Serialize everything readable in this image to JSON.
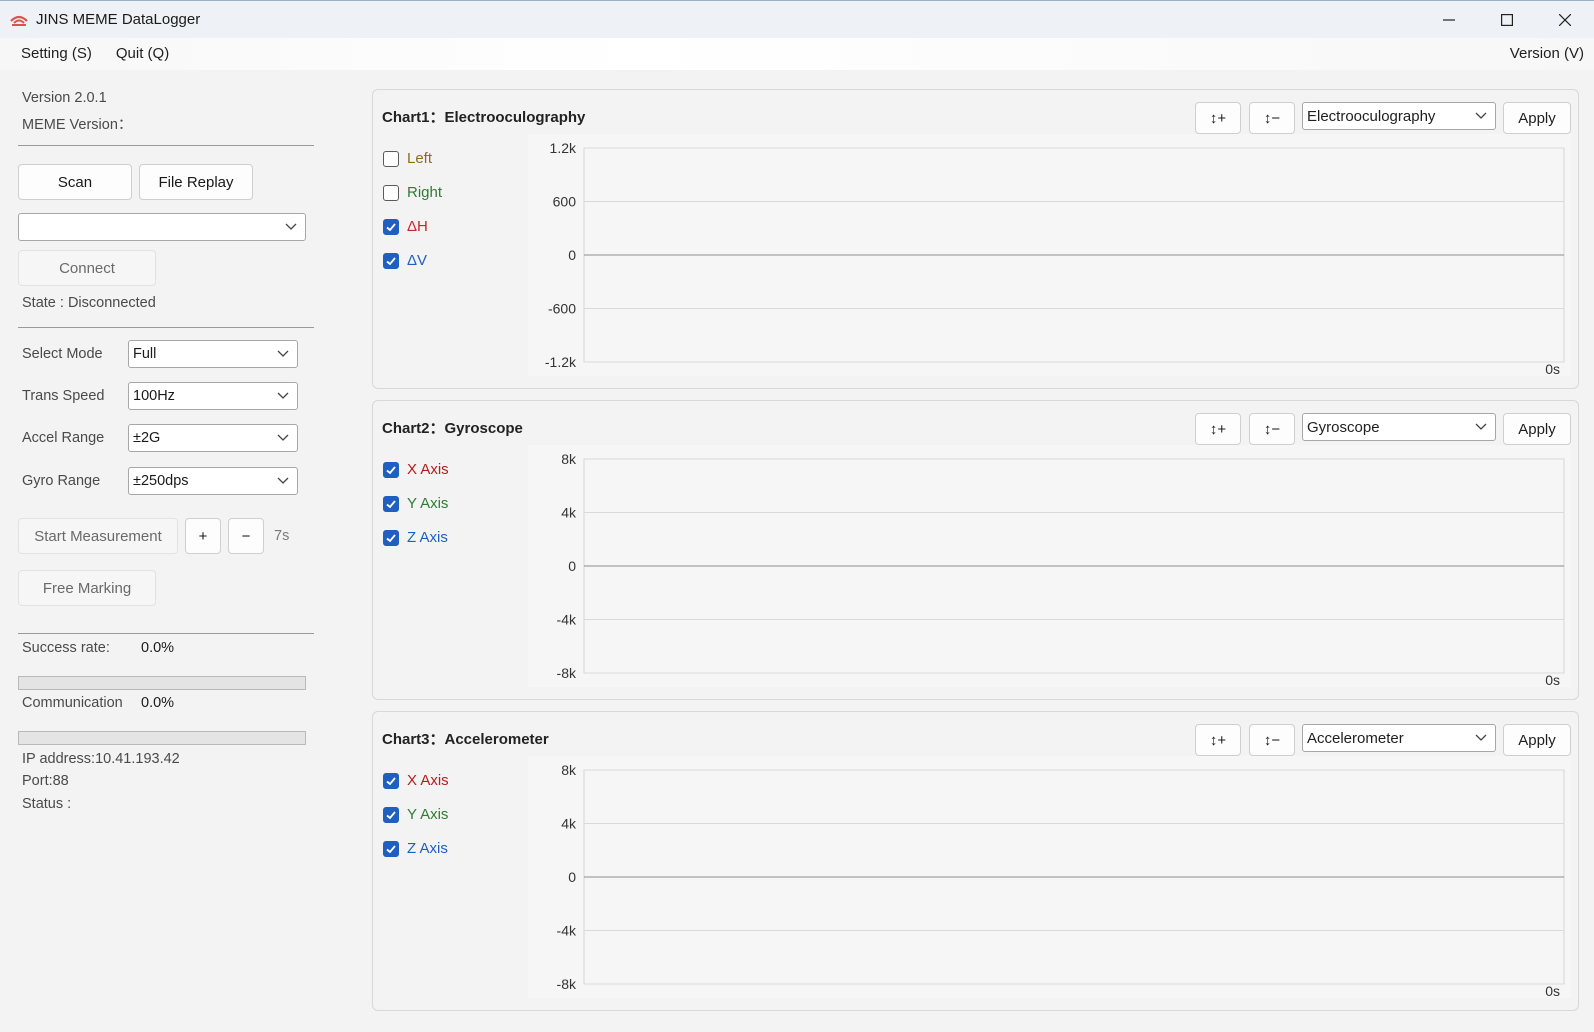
{
  "window": {
    "title": "JINS MEME DataLogger"
  },
  "menu": {
    "setting": "Setting (S)",
    "quit": "Quit (Q)",
    "version": "Version (V)"
  },
  "left": {
    "version_label": "Version 2.0.1",
    "meme_version_label": "MEME Version：",
    "scan_label": "Scan",
    "file_replay_label": "File Replay",
    "device_select_value": "",
    "connect_label": "Connect",
    "state_text": "State : Disconnected",
    "select_mode": {
      "label": "Select Mode",
      "value": "Full"
    },
    "trans_speed": {
      "label": "Trans Speed",
      "value": "100Hz"
    },
    "accel_range": {
      "label": "Accel Range",
      "value": "±2G"
    },
    "gyro_range": {
      "label": "Gyro Range",
      "value": "±250dps"
    },
    "start_measurement_label": "Start Measurement",
    "plus_label": "+",
    "minus_label": "−",
    "duration_text": "7s",
    "free_marking_label": "Free Marking",
    "success_rate": {
      "label": "Success rate:",
      "value": "0.0%",
      "progress": 0
    },
    "communication": {
      "label": "Communication",
      "value": "0.0%",
      "progress": 0
    },
    "ip_text": "IP address:10.41.193.42",
    "port_text": "Port:88",
    "status_text": "Status :"
  },
  "charts": [
    {
      "title": "Chart1：Electrooculography",
      "zoom_in_label": "↕+",
      "zoom_out_label": "↕−",
      "select_value": "Electrooculography",
      "apply_label": "Apply",
      "series": [
        {
          "name": "Left",
          "checked": false,
          "color": "#8a6d1f"
        },
        {
          "name": "Right",
          "checked": false,
          "color": "#2e7d32"
        },
        {
          "name": "ΔH",
          "checked": true,
          "color": "#c62828"
        },
        {
          "name": "ΔV",
          "checked": true,
          "color": "#1f5fbf"
        }
      ],
      "y_ticks": [
        "1.2k",
        "600",
        "0",
        "-600",
        "-1.2k"
      ],
      "x_tick": "0s"
    },
    {
      "title": "Chart2：Gyroscope",
      "zoom_in_label": "↕+",
      "zoom_out_label": "↕−",
      "select_value": "Gyroscope",
      "apply_label": "Apply",
      "series": [
        {
          "name": "X Axis",
          "checked": true,
          "color": "#b71c1c"
        },
        {
          "name": "Y Axis",
          "checked": true,
          "color": "#2e7d32"
        },
        {
          "name": "Z Axis",
          "checked": true,
          "color": "#1f5fbf"
        }
      ],
      "y_ticks": [
        "8k",
        "4k",
        "0",
        "-4k",
        "-8k"
      ],
      "x_tick": "0s"
    },
    {
      "title": "Chart3：Accelerometer",
      "zoom_in_label": "↕+",
      "zoom_out_label": "↕−",
      "select_value": "Accelerometer",
      "apply_label": "Apply",
      "series": [
        {
          "name": "X Axis",
          "checked": true,
          "color": "#b71c1c"
        },
        {
          "name": "Y Axis",
          "checked": true,
          "color": "#2e7d32"
        },
        {
          "name": "Z Axis",
          "checked": true,
          "color": "#1f5fbf"
        }
      ],
      "y_ticks": [
        "8k",
        "4k",
        "0",
        "-4k",
        "-8k"
      ],
      "x_tick": "0s"
    }
  ]
}
